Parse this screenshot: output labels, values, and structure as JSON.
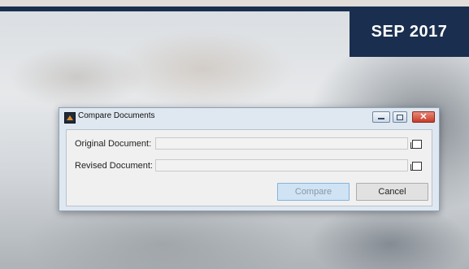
{
  "banner": {
    "date": "SEP 2017"
  },
  "dialog": {
    "title": "Compare Documents",
    "icons": {
      "app": "app-logo-icon",
      "minimize": "minimize-icon",
      "maximize": "maximize-icon",
      "close": "close-icon",
      "browse": "browse-folder-icon"
    },
    "close_glyph": "✕",
    "original_label": "Original Document:",
    "original_value": "",
    "revised_label": "Revised Document:",
    "revised_value": "",
    "compare_label": "Compare",
    "cancel_label": "Cancel"
  },
  "colors": {
    "banner_bg": "#1a2f4f",
    "banner_text": "#ffffff",
    "compare_button_bg": "#cfe3f5",
    "close_button": "#c73b27"
  }
}
